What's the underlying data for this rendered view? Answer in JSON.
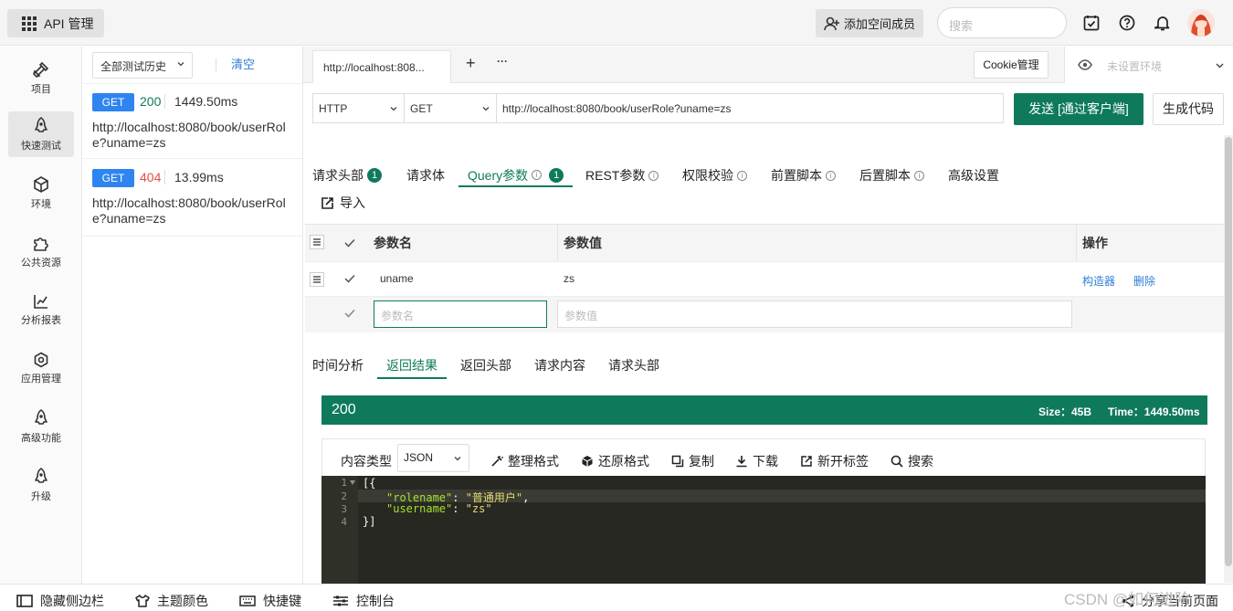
{
  "app": {
    "title": "API 管理"
  },
  "topbar": {
    "add_member": "添加空间成员",
    "search_placeholder": "搜索"
  },
  "nav": [
    {
      "label": "项目",
      "icon": "project-icon"
    },
    {
      "label": "快速测试",
      "icon": "rocket-icon",
      "active": true
    },
    {
      "label": "环境",
      "icon": "environment-icon"
    },
    {
      "label": "公共资源",
      "icon": "puzzle-icon"
    },
    {
      "label": "分析报表",
      "icon": "chart-icon"
    },
    {
      "label": "应用管理",
      "icon": "settings-icon"
    },
    {
      "label": "高级功能",
      "icon": "rocket-icon"
    },
    {
      "label": "升级",
      "icon": "rocket-icon"
    }
  ],
  "history": {
    "filter": "全部测试历史",
    "clear": "清空",
    "items": [
      {
        "method": "GET",
        "status": "200",
        "status_color": "#0e7a5b",
        "time": "1449.50ms",
        "url": "http://localhost:8080/book/userRole?uname=zs"
      },
      {
        "method": "GET",
        "status": "404",
        "status_color": "#e24b4b",
        "time": "13.99ms",
        "url": "http://localhost:8080/book/userRole?uname=zs"
      }
    ]
  },
  "tabs": {
    "active_tab": "http://localhost:808...",
    "add": "+",
    "more": "···"
  },
  "cookie": "Cookie管理",
  "env": {
    "placeholder": "未设置环境"
  },
  "request": {
    "protocol": "HTTP",
    "method": "GET",
    "url": "http://localhost:8080/book/userRole?uname=zs",
    "send": "发送 [通过客户端]",
    "gen_code": "生成代码"
  },
  "param_tabs": [
    {
      "label": "请求头部",
      "badge": "1"
    },
    {
      "label": "请求体"
    },
    {
      "label": "Query参数",
      "badge": "1",
      "info": true,
      "active": true
    },
    {
      "label": "REST参数",
      "info": true
    },
    {
      "label": "权限校验",
      "info": true
    },
    {
      "label": "前置脚本",
      "info": true
    },
    {
      "label": "后置脚本",
      "info": true
    },
    {
      "label": "高级设置"
    }
  ],
  "import": "导入",
  "params": {
    "headers": {
      "name": "参数名",
      "value": "参数值",
      "op": "操作"
    },
    "rows": [
      {
        "name": "uname",
        "value": "zs",
        "builder": "构造器",
        "delete": "删除"
      }
    ],
    "new_name_placeholder": "参数名",
    "new_value_placeholder": "参数值"
  },
  "resp_tabs": [
    {
      "label": "时间分析"
    },
    {
      "label": "返回结果",
      "active": true
    },
    {
      "label": "返回头部"
    },
    {
      "label": "请求内容"
    },
    {
      "label": "请求头部"
    }
  ],
  "response": {
    "status": "200",
    "size": "Size：45B",
    "time": "Time：1449.50ms"
  },
  "toolbar": {
    "content_type_label": "内容类型",
    "content_type": "JSON",
    "format": "整理格式",
    "restore": "还原格式",
    "copy": "复制",
    "download": "下载",
    "new_tab": "新开标签",
    "search": "搜索"
  },
  "code_lines": [
    {
      "n": "1",
      "text": "[{"
    },
    {
      "n": "2",
      "key": "\"rolename\"",
      "sep": ": ",
      "val": "\"普通用户\"",
      "tail": ","
    },
    {
      "n": "3",
      "key": "\"username\"",
      "sep": ": ",
      "val": "\"zs\"",
      "tail": ""
    },
    {
      "n": "4",
      "text": "}]"
    }
  ],
  "footer": {
    "hide_sidebar": "隐藏侧边栏",
    "theme": "主题颜色",
    "shortcuts": "快捷键",
    "console": "控制台",
    "share": "分享当前页面",
    "watermark": "CSDN @如何进阶"
  }
}
